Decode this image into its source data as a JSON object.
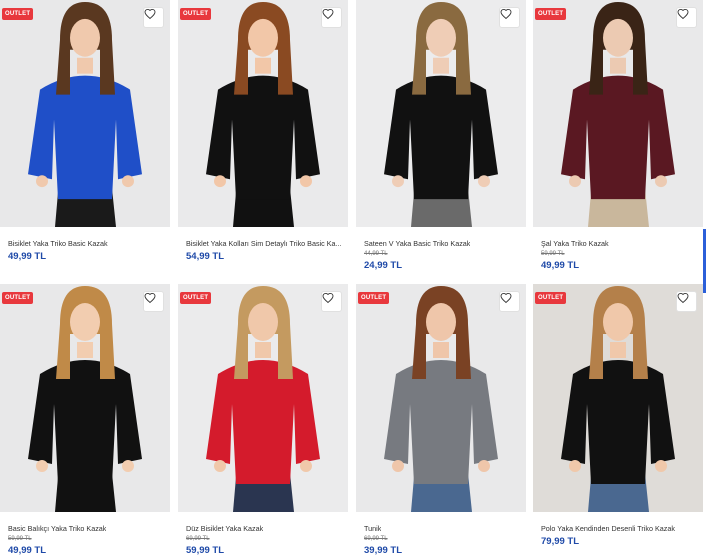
{
  "products": [
    {
      "name": "Bisiklet Yaka Triko Basic Kazak",
      "price": "49,99 TL",
      "old_price": "",
      "badge": "OUTLET",
      "sweater": "#1f4fc8",
      "hair": "#5a3820",
      "skin": "#f0c9ad",
      "pants": "#1a1a1a",
      "bg": "#e8e8e9"
    },
    {
      "name": "Bisiklet Yaka Kolları Sim Detaylı Triko Basic Ka...",
      "price": "54,99 TL",
      "old_price": "",
      "badge": "OUTLET",
      "sweater": "#111111",
      "hair": "#8a4a22",
      "skin": "#f2c7a8",
      "pants": "#111111",
      "bg": "#eaeaeb"
    },
    {
      "name": "Sateen V Yaka Basic Triko Kazak",
      "price": "24,99 TL",
      "old_price": "44,99 TL",
      "badge": "",
      "sweater": "#111111",
      "hair": "#8a6a40",
      "skin": "#efcdb6",
      "pants": "#6a6a6a",
      "bg": "#ececed"
    },
    {
      "name": "Şal Yaka Triko Kazak",
      "price": "49,99 TL",
      "old_price": "59,99 TL",
      "badge": "OUTLET",
      "sweater": "#5a1822",
      "hair": "#3a2416",
      "skin": "#eccab2",
      "pants": "#c9b79c",
      "bg": "#e9e9ea"
    },
    {
      "name": "Basic Balıkçı Yaka Triko Kazak",
      "price": "49,99 TL",
      "old_price": "59,99 TL",
      "badge": "OUTLET",
      "sweater": "#111111",
      "hair": "#c08a48",
      "skin": "#f2cdb0",
      "pants": "#111111",
      "bg": "#e8e8e9"
    },
    {
      "name": "Düz Bisiklet Yaka Kazak",
      "price": "59,99 TL",
      "old_price": "69,99 TL",
      "badge": "OUTLET",
      "sweater": "#d41b2c",
      "hair": "#c49a60",
      "skin": "#f0c8aa",
      "pants": "#2a3550",
      "bg": "#ebebec"
    },
    {
      "name": "Tunik",
      "price": "39,99 TL",
      "old_price": "69,99 TL",
      "badge": "OUTLET",
      "sweater": "#777a80",
      "hair": "#7a4224",
      "skin": "#efc6aa",
      "pants": "#4a6890",
      "bg": "#e9e9ea"
    },
    {
      "name": "Polo Yaka Kendinden Desenli Triko Kazak",
      "price": "79,99 TL",
      "old_price": "",
      "badge": "OUTLET",
      "sweater": "#111111",
      "hair": "#b4804a",
      "skin": "#f0c8aa",
      "pants": "#4a6890",
      "bg": "#dfdcd8"
    }
  ],
  "icons": {
    "favorite": "heart-outline-icon"
  }
}
